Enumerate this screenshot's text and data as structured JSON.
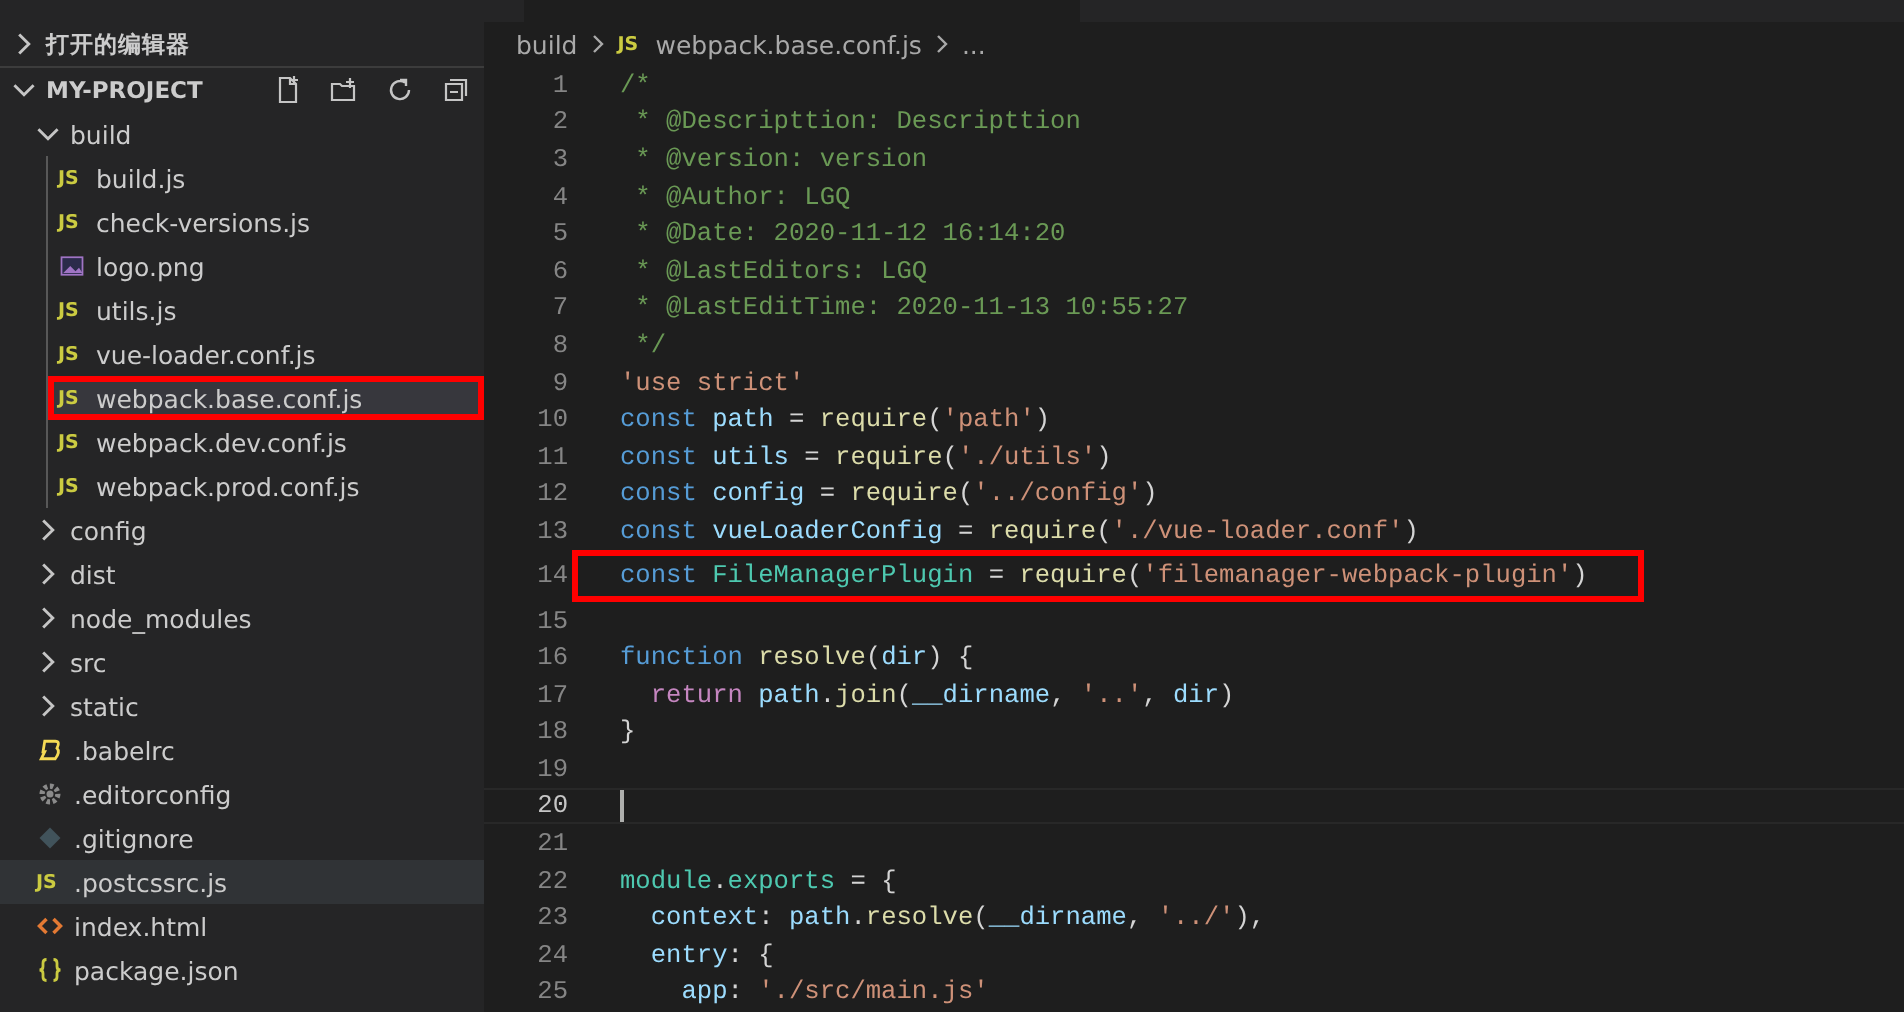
{
  "sidebar": {
    "open_editors": {
      "label": "打开的编辑器",
      "expanded": false
    },
    "project": {
      "title": "MY-PROJECT",
      "expanded": true,
      "items": [
        {
          "label": "build",
          "kind": "folder",
          "expanded": true,
          "selected": false,
          "hovered": false,
          "annotated": false,
          "children": [
            {
              "label": "build.js",
              "kind": "js",
              "icon_text": "JS",
              "selected": false,
              "hovered": false,
              "annotated": false
            },
            {
              "label": "check-versions.js",
              "kind": "js",
              "icon_text": "JS",
              "selected": false,
              "hovered": false,
              "annotated": false
            },
            {
              "label": "logo.png",
              "kind": "image",
              "selected": false,
              "hovered": false,
              "annotated": false
            },
            {
              "label": "utils.js",
              "kind": "js",
              "icon_text": "JS",
              "selected": false,
              "hovered": false,
              "annotated": false
            },
            {
              "label": "vue-loader.conf.js",
              "kind": "js",
              "icon_text": "JS",
              "selected": false,
              "hovered": false,
              "annotated": false
            },
            {
              "label": "webpack.base.conf.js",
              "kind": "js",
              "icon_text": "JS",
              "selected": true,
              "hovered": false,
              "annotated": true
            },
            {
              "label": "webpack.dev.conf.js",
              "kind": "js",
              "icon_text": "JS",
              "selected": false,
              "hovered": false,
              "annotated": false
            },
            {
              "label": "webpack.prod.conf.js",
              "kind": "js",
              "icon_text": "JS",
              "selected": false,
              "hovered": false,
              "annotated": false
            }
          ]
        },
        {
          "label": "config",
          "kind": "folder",
          "expanded": false,
          "selected": false,
          "hovered": false,
          "annotated": false
        },
        {
          "label": "dist",
          "kind": "folder",
          "expanded": false,
          "selected": false,
          "hovered": false,
          "annotated": false
        },
        {
          "label": "node_modules",
          "kind": "folder",
          "expanded": false,
          "selected": false,
          "hovered": false,
          "annotated": false
        },
        {
          "label": "src",
          "kind": "folder",
          "expanded": false,
          "selected": false,
          "hovered": false,
          "annotated": false
        },
        {
          "label": "static",
          "kind": "folder",
          "expanded": false,
          "selected": false,
          "hovered": false,
          "annotated": false
        },
        {
          "label": ".babelrc",
          "kind": "babel",
          "selected": false,
          "hovered": false,
          "annotated": false
        },
        {
          "label": ".editorconfig",
          "kind": "gear",
          "selected": false,
          "hovered": false,
          "annotated": false
        },
        {
          "label": ".gitignore",
          "kind": "git",
          "selected": false,
          "hovered": false,
          "annotated": false
        },
        {
          "label": ".postcssrc.js",
          "kind": "js",
          "icon_text": "JS",
          "selected": false,
          "hovered": true,
          "annotated": false
        },
        {
          "label": "index.html",
          "kind": "html",
          "selected": false,
          "hovered": false,
          "annotated": false
        },
        {
          "label": "package.json",
          "kind": "json",
          "selected": false,
          "hovered": false,
          "annotated": false
        }
      ]
    }
  },
  "editor": {
    "breadcrumb": {
      "folder": "build",
      "file_icon_text": "JS",
      "file": "webpack.base.conf.js",
      "more": "..."
    },
    "lines": [
      {
        "number": "1",
        "current": false,
        "annotated": false,
        "tokens": [
          {
            "kind": "c",
            "text": "/*"
          }
        ]
      },
      {
        "number": "2",
        "current": false,
        "annotated": false,
        "tokens": [
          {
            "kind": "c",
            "text": " * @Descripttion: Descripttion"
          }
        ]
      },
      {
        "number": "3",
        "current": false,
        "annotated": false,
        "tokens": [
          {
            "kind": "c",
            "text": " * @version: version"
          }
        ]
      },
      {
        "number": "4",
        "current": false,
        "annotated": false,
        "tokens": [
          {
            "kind": "c",
            "text": " * @Author: LGQ"
          }
        ]
      },
      {
        "number": "5",
        "current": false,
        "annotated": false,
        "tokens": [
          {
            "kind": "c",
            "text": " * @Date: 2020-11-12 16:14:20"
          }
        ]
      },
      {
        "number": "6",
        "current": false,
        "annotated": false,
        "tokens": [
          {
            "kind": "c",
            "text": " * @LastEditors: LGQ"
          }
        ]
      },
      {
        "number": "7",
        "current": false,
        "annotated": false,
        "tokens": [
          {
            "kind": "c",
            "text": " * @LastEditTime: 2020-11-13 10:55:27"
          }
        ]
      },
      {
        "number": "8",
        "current": false,
        "annotated": false,
        "tokens": [
          {
            "kind": "c",
            "text": " */"
          }
        ]
      },
      {
        "number": "9",
        "current": false,
        "annotated": false,
        "tokens": [
          {
            "kind": "s",
            "text": "'use strict'"
          }
        ]
      },
      {
        "number": "10",
        "current": false,
        "annotated": false,
        "tokens": [
          {
            "kind": "kw",
            "text": "const "
          },
          {
            "kind": "v",
            "text": "path"
          },
          {
            "kind": "p",
            "text": " = "
          },
          {
            "kind": "f",
            "text": "require"
          },
          {
            "kind": "p",
            "text": "("
          },
          {
            "kind": "s",
            "text": "'path'"
          },
          {
            "kind": "p",
            "text": ")"
          }
        ]
      },
      {
        "number": "11",
        "current": false,
        "annotated": false,
        "tokens": [
          {
            "kind": "kw",
            "text": "const "
          },
          {
            "kind": "v",
            "text": "utils"
          },
          {
            "kind": "p",
            "text": " = "
          },
          {
            "kind": "f",
            "text": "require"
          },
          {
            "kind": "p",
            "text": "("
          },
          {
            "kind": "s",
            "text": "'./utils'"
          },
          {
            "kind": "p",
            "text": ")"
          }
        ]
      },
      {
        "number": "12",
        "current": false,
        "annotated": false,
        "tokens": [
          {
            "kind": "kw",
            "text": "const "
          },
          {
            "kind": "v",
            "text": "config"
          },
          {
            "kind": "p",
            "text": " = "
          },
          {
            "kind": "f",
            "text": "require"
          },
          {
            "kind": "p",
            "text": "("
          },
          {
            "kind": "s",
            "text": "'../config'"
          },
          {
            "kind": "p",
            "text": ")"
          }
        ]
      },
      {
        "number": "13",
        "current": false,
        "annotated": false,
        "tokens": [
          {
            "kind": "kw",
            "text": "const "
          },
          {
            "kind": "v",
            "text": "vueLoaderConfig"
          },
          {
            "kind": "p",
            "text": " = "
          },
          {
            "kind": "f",
            "text": "require"
          },
          {
            "kind": "p",
            "text": "("
          },
          {
            "kind": "s",
            "text": "'./vue-loader.conf'"
          },
          {
            "kind": "p",
            "text": ")"
          }
        ]
      },
      {
        "number": "14",
        "current": false,
        "annotated": true,
        "tokens": [
          {
            "kind": "kw",
            "text": "const "
          },
          {
            "kind": "t",
            "text": "FileManagerPlugin"
          },
          {
            "kind": "p",
            "text": " = "
          },
          {
            "kind": "f",
            "text": "require"
          },
          {
            "kind": "p",
            "text": "("
          },
          {
            "kind": "s",
            "text": "'filemanager-webpack-plugin'"
          },
          {
            "kind": "p",
            "text": ")"
          }
        ]
      },
      {
        "number": "15",
        "current": false,
        "annotated": false
      },
      {
        "number": "16",
        "current": false,
        "annotated": false,
        "tokens": [
          {
            "kind": "kw",
            "text": "function "
          },
          {
            "kind": "f",
            "text": "resolve"
          },
          {
            "kind": "p",
            "text": "("
          },
          {
            "kind": "v",
            "text": "dir"
          },
          {
            "kind": "p",
            "text": ") {"
          }
        ]
      },
      {
        "number": "17",
        "current": false,
        "annotated": false,
        "tokens": [
          {
            "kind": "r",
            "text": "  return "
          },
          {
            "kind": "v",
            "text": "path"
          },
          {
            "kind": "p",
            "text": "."
          },
          {
            "kind": "f",
            "text": "join"
          },
          {
            "kind": "p",
            "text": "("
          },
          {
            "kind": "v",
            "text": "__dirname"
          },
          {
            "kind": "p",
            "text": ", "
          },
          {
            "kind": "s",
            "text": "'..'"
          },
          {
            "kind": "p",
            "text": ", "
          },
          {
            "kind": "v",
            "text": "dir"
          },
          {
            "kind": "p",
            "text": ")"
          }
        ]
      },
      {
        "number": "18",
        "current": false,
        "annotated": false,
        "tokens": [
          {
            "kind": "p",
            "text": "}"
          }
        ]
      },
      {
        "number": "19",
        "current": false,
        "annotated": false
      },
      {
        "number": "20",
        "current": true,
        "annotated": false
      },
      {
        "number": "21",
        "current": false,
        "annotated": false
      },
      {
        "number": "22",
        "current": false,
        "annotated": false,
        "tokens": [
          {
            "kind": "t",
            "text": "module"
          },
          {
            "kind": "p",
            "text": "."
          },
          {
            "kind": "t",
            "text": "exports"
          },
          {
            "kind": "p",
            "text": " = {"
          }
        ]
      },
      {
        "number": "23",
        "current": false,
        "annotated": false,
        "tokens": [
          {
            "kind": "v",
            "text": "  context"
          },
          {
            "kind": "p",
            "text": ": "
          },
          {
            "kind": "v",
            "text": "path"
          },
          {
            "kind": "p",
            "text": "."
          },
          {
            "kind": "f",
            "text": "resolve"
          },
          {
            "kind": "p",
            "text": "("
          },
          {
            "kind": "v",
            "text": "__dirname"
          },
          {
            "kind": "p",
            "text": ", "
          },
          {
            "kind": "s",
            "text": "'../'"
          },
          {
            "kind": "p",
            "text": "),"
          }
        ]
      },
      {
        "number": "24",
        "current": false,
        "annotated": false,
        "tokens": [
          {
            "kind": "v",
            "text": "  entry"
          },
          {
            "kind": "p",
            "text": ": {"
          }
        ]
      },
      {
        "number": "25",
        "current": false,
        "annotated": false,
        "tokens": [
          {
            "kind": "v",
            "text": "    app"
          },
          {
            "kind": "p",
            "text": ": "
          },
          {
            "kind": "s",
            "text": "'./src/main.js'"
          }
        ]
      }
    ]
  }
}
